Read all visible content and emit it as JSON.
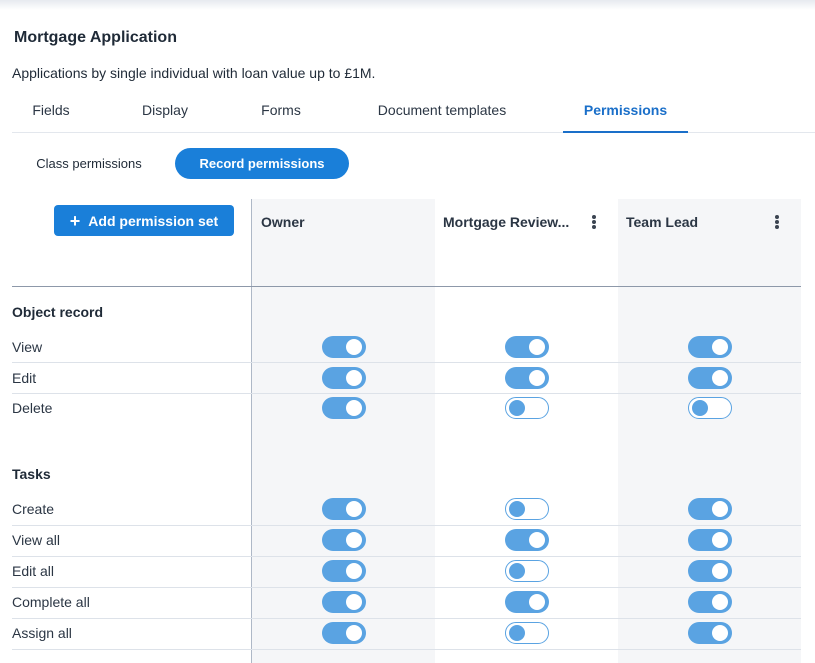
{
  "header": {
    "title": "Mortgage Application",
    "subtitle": "Applications by single individual with loan value up to £1M."
  },
  "tabs": [
    {
      "label": "Fields",
      "active": false
    },
    {
      "label": "Display",
      "active": false
    },
    {
      "label": "Forms",
      "active": false
    },
    {
      "label": "Document templates",
      "active": false
    },
    {
      "label": "Permissions",
      "active": true
    }
  ],
  "permission_toggle": {
    "class_label": "Class permissions",
    "record_label": "Record permissions",
    "selected": "Record permissions"
  },
  "add_button": {
    "label": "Add permission set",
    "icon": "plus-icon"
  },
  "columns": [
    "Owner",
    "Mortgage Review...",
    "Team Lead"
  ],
  "sections": [
    {
      "title": "Object record",
      "rows": [
        {
          "label": "View",
          "values": [
            true,
            true,
            true
          ]
        },
        {
          "label": "Edit",
          "values": [
            true,
            true,
            true
          ]
        },
        {
          "label": "Delete",
          "values": [
            true,
            false,
            false
          ]
        }
      ]
    },
    {
      "title": "Tasks",
      "rows": [
        {
          "label": "Create",
          "values": [
            true,
            false,
            true
          ]
        },
        {
          "label": "View all",
          "values": [
            true,
            true,
            true
          ]
        },
        {
          "label": "Edit all",
          "values": [
            true,
            false,
            true
          ]
        },
        {
          "label": "Complete all",
          "values": [
            true,
            true,
            true
          ]
        },
        {
          "label": "Assign all",
          "values": [
            true,
            false,
            true
          ]
        }
      ]
    }
  ],
  "colors": {
    "accent": "#1a7fd9",
    "toggle": "#5aa3e2",
    "text": "#1f2a37"
  }
}
